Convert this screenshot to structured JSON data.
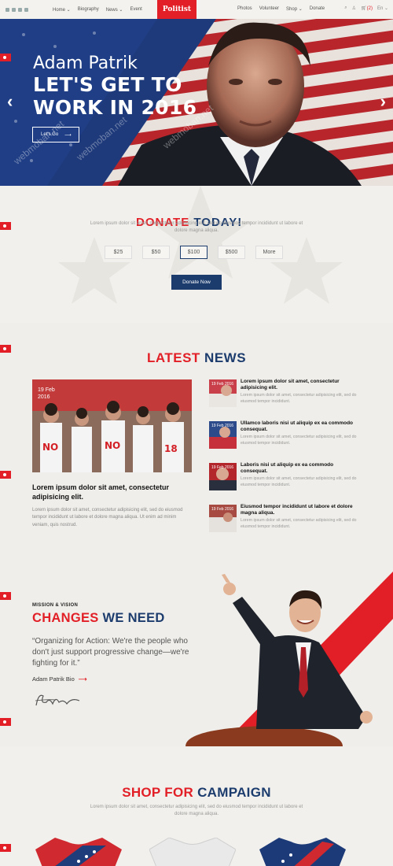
{
  "nav": {
    "left": [
      "Home",
      "Biography",
      "News",
      "Event"
    ],
    "left_dropdowns": [
      "Home",
      "News"
    ],
    "logo": "Politist",
    "right": [
      "Photos",
      "Volunteer",
      "Shop",
      "Donate"
    ],
    "cart_count": "(2)",
    "lang": "En"
  },
  "hero": {
    "name": "Adam Patrik",
    "tagline": "LET'S GET TO WORK IN 2016",
    "button": "Let's Go",
    "watermark": "webmoban.net"
  },
  "donate": {
    "title_a": "DONATE",
    "title_b": "TODAY!",
    "text": "Lorem ipsum dolor sit amet, consectetur adipisicing elit, sed do eiusmod tempor incididunt ut labore et dolore magna aliqua.",
    "amounts": [
      "$25",
      "$50",
      "$100",
      "$500",
      "More"
    ],
    "selected": "$100",
    "button": "Donate Now"
  },
  "news": {
    "title_a": "LATEST",
    "title_b": "NEWS",
    "feature": {
      "date": "19 Feb 2016",
      "title": "Lorem ipsum dolor sit amet, consectetur adipisicing elit.",
      "text": "Lorem ipsum dolor sit amet, consectetur adipisicing elit, sed do eiusmod tempor incididunt ut labore et dolore magna aliqua. Ut enim ad minim veniam, quis nostrud."
    },
    "items": [
      {
        "date": "19 Feb 2016",
        "title": "Lorem ipsum dolor sit amet, consectetur adipisicing elit.",
        "text": "Lorem ipsum dolor sit amet, consectetur adipisicing elit, sed do eiusmod tempor incididunt."
      },
      {
        "date": "19 Feb 2016",
        "title": "Ullamco laboris nisi ut aliquip ex ea commodo consequat.",
        "text": "Lorem ipsum dolor sit amet, consectetur adipisicing elit, sed do eiusmod tempor incididunt."
      },
      {
        "date": "19 Feb 2016",
        "title": "Laboris nisi ut aliquip ex ea commodo consequat.",
        "text": "Lorem ipsum dolor sit amet, consectetur adipisicing elit, sed do eiusmod tempor incididunt."
      },
      {
        "date": "19 Feb 2016",
        "title": "Eiusmod tempor incididunt ut labore et dolore magna aliqua.",
        "text": "Lorem ipsum dolor sit amet, consectetur adipisicing elit, sed do eiusmod tempor incididunt."
      }
    ]
  },
  "mission": {
    "eyebrow": "MISSION & VISION",
    "title_a": "CHANGES",
    "title_b": "WE NEED",
    "quote": "“Organizing for Action: We're the people who don't just support progressive change—we're fighting for it.”",
    "link": "Adam Patrik Bio"
  },
  "shop": {
    "title_a": "SHOP FOR",
    "title_b": "CAMPAIGN",
    "text": "Lorem ipsum dolor sit amet, consectetur adipisicing elit, sed do eiusmod tempor incididunt ut labore et dolore magna aliqua."
  },
  "colors": {
    "red": "#e21f26",
    "navy": "#1c3c6e",
    "bg": "#f3f2ee"
  }
}
